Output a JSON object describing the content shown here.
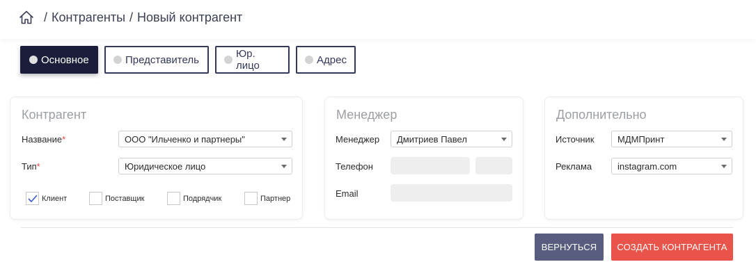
{
  "breadcrumb": {
    "icon": "home-icon",
    "sep1": "/",
    "item1": "Контрагенты",
    "sep2": "/",
    "item2": "Новый контрагент"
  },
  "tabs": [
    {
      "label": "Основное",
      "active": true
    },
    {
      "label": "Представитель",
      "active": false
    },
    {
      "label": "Юр. лицо",
      "active": false
    },
    {
      "label": "Адрес",
      "active": false
    }
  ],
  "counterparty": {
    "title": "Контрагент",
    "name_label": "Название",
    "name_required": "*",
    "name_value": "ООО \"Ильченко и партнеры\"",
    "type_label": "Тип",
    "type_required": "*",
    "type_value": "Юридическое лицо",
    "roles": [
      {
        "label": "Клиент",
        "checked": true
      },
      {
        "label": "Поставщик",
        "checked": false
      },
      {
        "label": "Подрядчик",
        "checked": false
      },
      {
        "label": "Партнер",
        "checked": false
      }
    ]
  },
  "manager": {
    "title": "Менеджер",
    "manager_label": "Менеджер",
    "manager_value": "Дмитриев Павел",
    "phone_label": "Телефон",
    "email_label": "Email"
  },
  "extra": {
    "title": "Дополнительно",
    "source_label": "Источник",
    "source_value": "МДМПринт",
    "ads_label": "Реклама",
    "ads_value": "instagram.com"
  },
  "actions": {
    "back_label": "ВЕРНУТЬСЯ",
    "create_label": "СОЗДАТЬ КОНТРАГЕНТА"
  },
  "colors": {
    "tab_active": "#1c1d3b",
    "back_button": "#585c7e",
    "create_button": "#e8534a",
    "required": "#e0453e"
  }
}
